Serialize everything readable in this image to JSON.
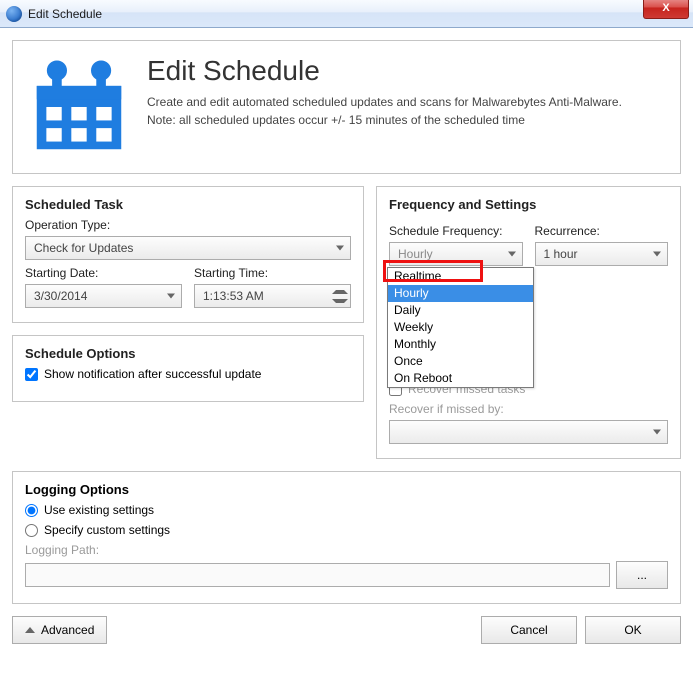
{
  "window": {
    "title": "Edit Schedule",
    "close_label": "X"
  },
  "header": {
    "title": "Edit Schedule",
    "desc1": "Create and edit automated scheduled updates and scans for Malwarebytes Anti-Malware.",
    "desc2": "Note: all scheduled updates occur +/- 15 minutes of the scheduled time"
  },
  "scheduled_task": {
    "legend": "Scheduled Task",
    "operation_label": "Operation Type:",
    "operation_value": "Check for Updates",
    "starting_date_label": "Starting Date:",
    "starting_date_value": "3/30/2014",
    "starting_time_label": "Starting Time:",
    "starting_time_value": "1:13:53 AM"
  },
  "schedule_options": {
    "legend": "Schedule Options",
    "notify_label": "Show notification after successful update",
    "notify_checked": true
  },
  "frequency": {
    "legend": "Frequency and Settings",
    "freq_label": "Schedule Frequency:",
    "freq_value": "Hourly",
    "freq_options": [
      "Realtime",
      "Hourly",
      "Daily",
      "Weekly",
      "Monthly",
      "Once",
      "On Reboot"
    ],
    "freq_selected_index": 1,
    "recur_label": "Recurrence:",
    "recur_value": "1 hour",
    "recover_missed_label": "Recover missed tasks",
    "recover_missed_checked": false,
    "recover_if_label": "Recover if missed by:",
    "recover_if_value": ""
  },
  "logging": {
    "legend": "Logging Options",
    "opt_existing": "Use existing settings",
    "opt_custom": "Specify custom settings",
    "selected": "existing",
    "path_label": "Logging Path:",
    "path_value": "",
    "browse_label": "..."
  },
  "footer": {
    "advanced": "Advanced",
    "cancel": "Cancel",
    "ok": "OK"
  },
  "colors": {
    "accent": "#1f7de0",
    "highlight_red": "#e11"
  }
}
